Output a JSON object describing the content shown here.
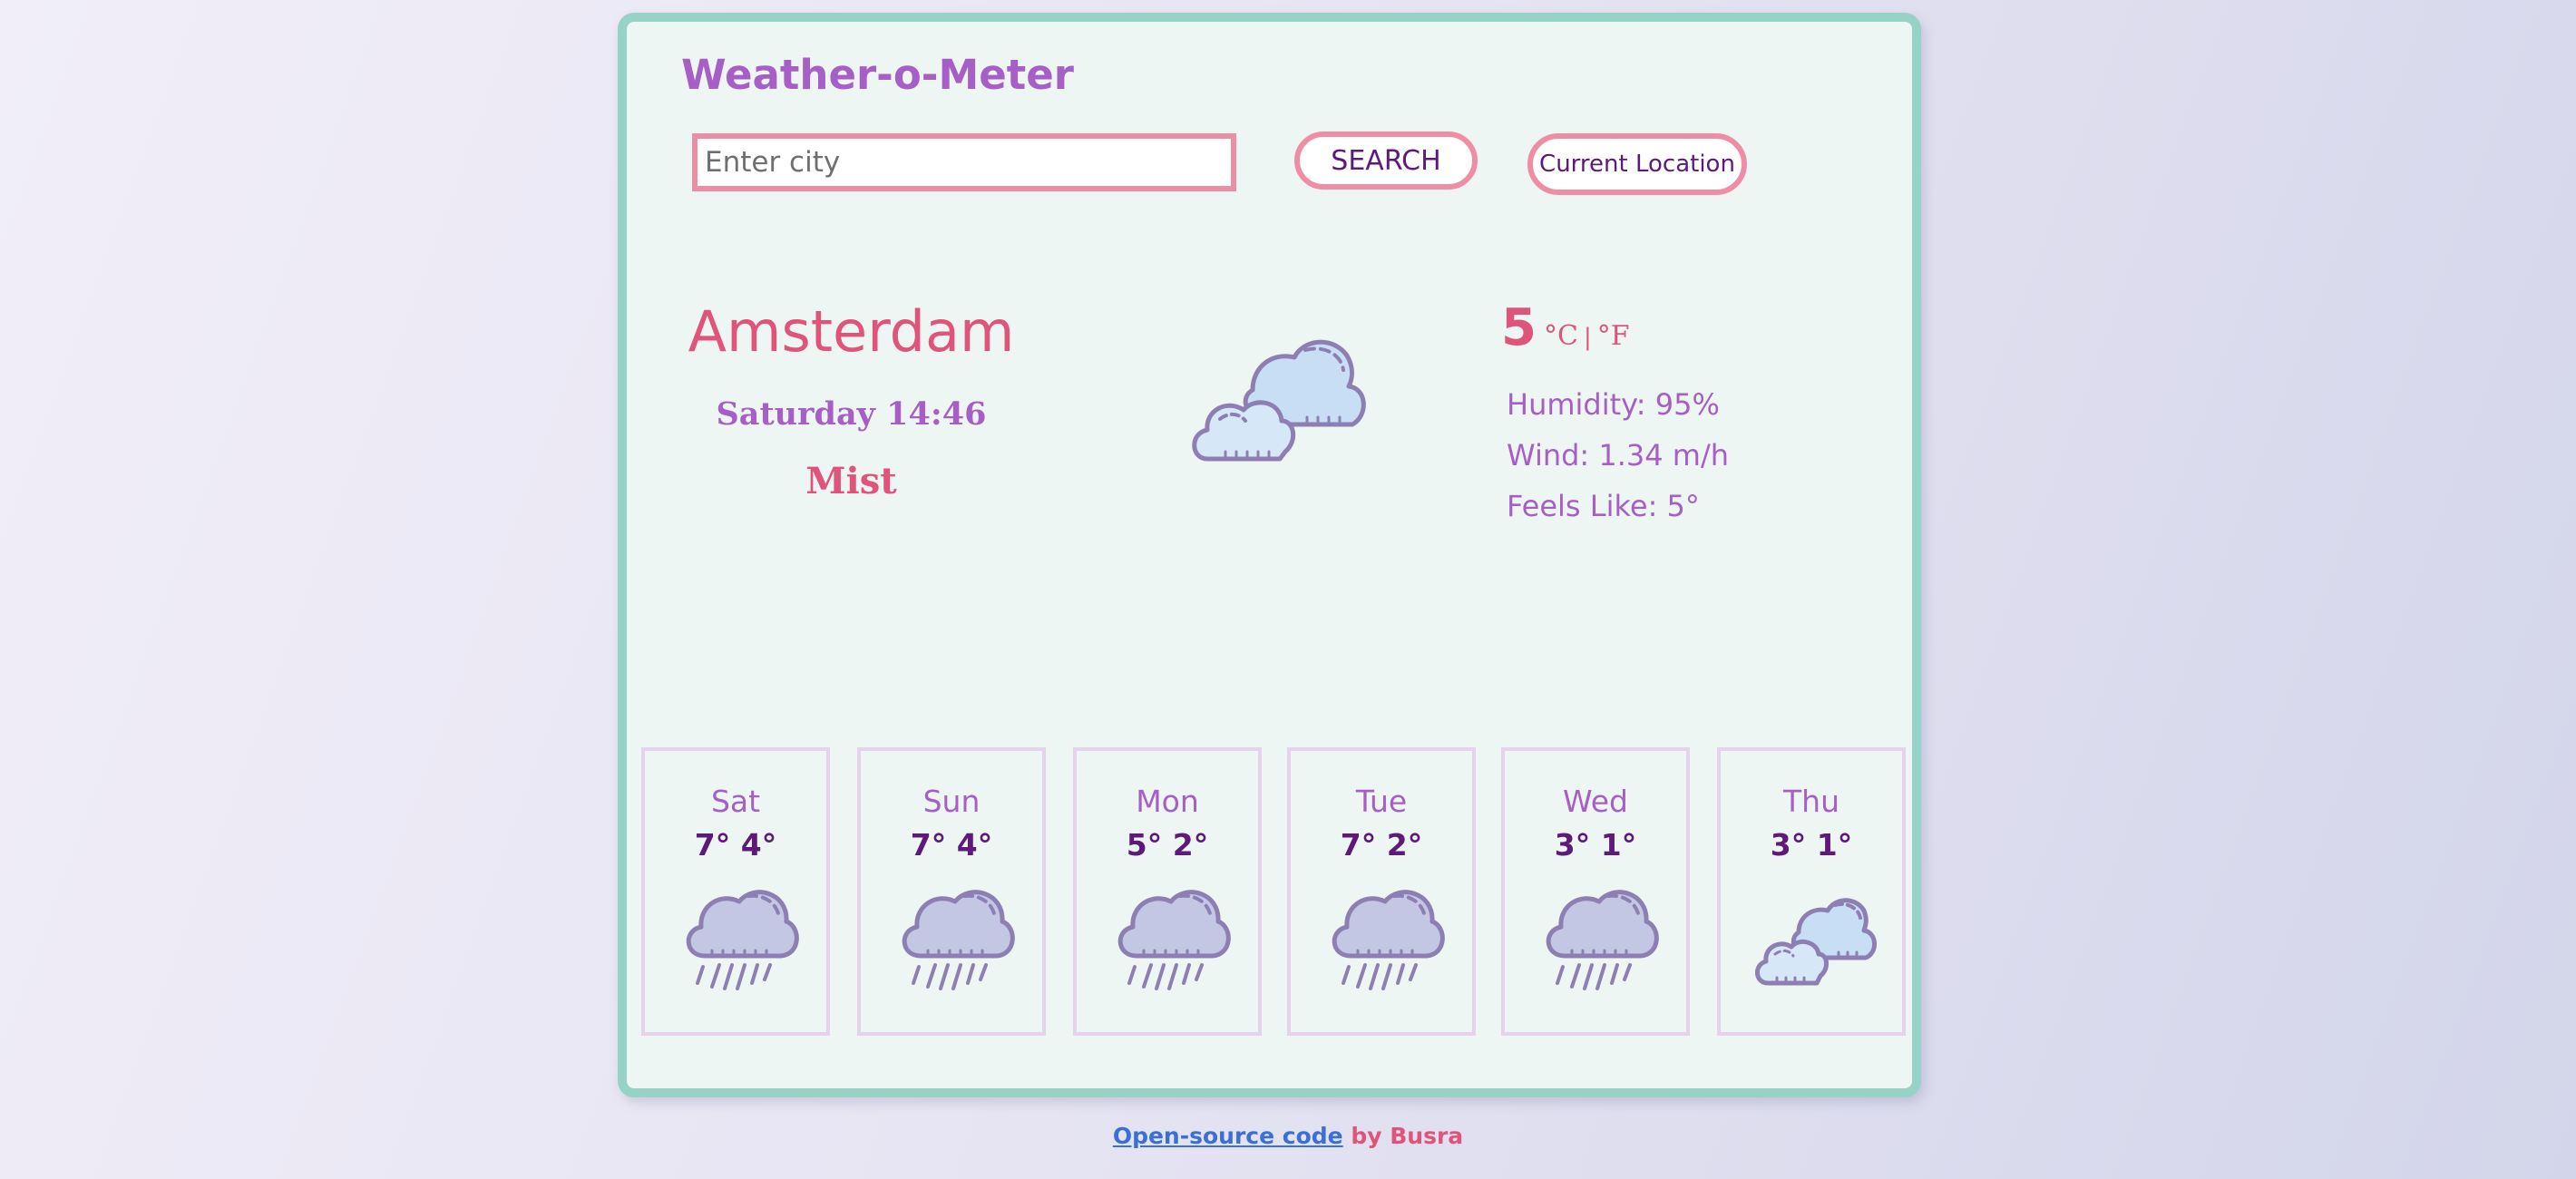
{
  "app": {
    "title": "Weather-o-Meter"
  },
  "search": {
    "placeholder": "Enter city",
    "value": "",
    "search_label": "SEARCH",
    "location_label": "Current Location"
  },
  "current": {
    "city": "Amsterdam",
    "datetime": "Saturday 14:46",
    "description": "Mist",
    "icon": "cloudy-icon",
    "temperature": "5",
    "unit_c": "°C",
    "unit_sep": "|",
    "unit_f": "°F",
    "humidity": "Humidity: 95%",
    "wind": "Wind: 1.34 m/h",
    "feels_like": "Feels Like: 5°"
  },
  "forecast": [
    {
      "day": "Sat",
      "temps": "7° 4°",
      "icon": "rain-icon"
    },
    {
      "day": "Sun",
      "temps": "7° 4°",
      "icon": "rain-icon"
    },
    {
      "day": "Mon",
      "temps": "5° 2°",
      "icon": "rain-icon"
    },
    {
      "day": "Tue",
      "temps": "7° 2°",
      "icon": "rain-icon"
    },
    {
      "day": "Wed",
      "temps": "3° 1°",
      "icon": "rain-icon"
    },
    {
      "day": "Thu",
      "temps": "3° 1°",
      "icon": "cloudy-icon"
    }
  ],
  "footer": {
    "link_label": "Open-source code",
    "by_label": "by Busra"
  },
  "colors": {
    "accent_pink": "#e0547a",
    "accent_purple": "#a65fc6",
    "card_border": "#96d2c6",
    "input_border": "#ee8ea5"
  }
}
